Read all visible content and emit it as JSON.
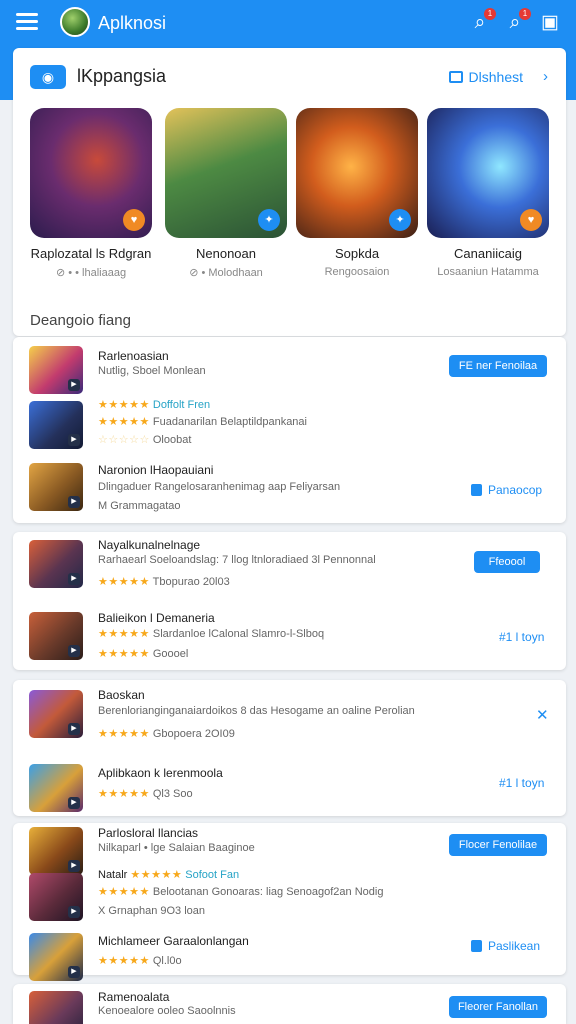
{
  "header": {
    "title": "Aplknosi",
    "icons": [
      "menu-icon",
      "search-icon",
      "search-alt-icon",
      "bookmark-icon"
    ],
    "badges": [
      "1",
      "1"
    ]
  },
  "featured": {
    "title": "lKppangsia",
    "link": "Dlshhest",
    "tiles": [
      {
        "name": "Raplozatal ls Rdgran",
        "sub": "⊘ • • lhaliaaag"
      },
      {
        "name": "Nenonoan",
        "sub": "⊘ • Molodhaan"
      },
      {
        "name": "Sopkda",
        "sub": "Rengoosaion"
      },
      {
        "name": "Cananiicaig",
        "sub": "Losaaniun Hatamma"
      }
    ],
    "section_label": "Deangoio fiang"
  },
  "lists": [
    {
      "items": [
        {
          "title": "Rarlenoasian",
          "lines": [
            {
              "text": "Nutlig, Sboel Monlean"
            }
          ],
          "action": {
            "type": "pill",
            "label": "FE ner Fenoilaa"
          }
        },
        {
          "title": "",
          "lines": [
            {
              "stars": "★★★★★",
              "note": "Doffolt Fren"
            },
            {
              "stars": "★★★★★",
              "text": "Fuadanarilan Belaptildpankanai"
            },
            {
              "stars": "☆☆☆☆☆",
              "text": "Oloobat"
            }
          ]
        },
        {
          "title": "Naronion lHaopauiani",
          "lines": [
            {
              "text": "Dlingaduer Rangelosaranhenimag aap Feliyarsan"
            },
            {
              "text": "M Grammagatao"
            }
          ],
          "action": {
            "type": "ghost",
            "label": "Panaocop"
          }
        }
      ]
    },
    {
      "items": [
        {
          "title": "Nayalkunalnelnage",
          "lines": [
            {
              "text": "Rarhaearl Soeloandslag: 7 llog ltnloradiaed 3l Pennonnal"
            },
            {
              "stars": "★★★★★",
              "text": "Tbopurao 20l03"
            }
          ],
          "action": {
            "type": "pill",
            "label": "Ffeoool"
          }
        },
        {
          "title": "Balieikon l Demaneria",
          "lines": [
            {
              "stars": "★★★★★",
              "text": "Slardanloe lCalonal Slamro-l-Slboq"
            },
            {
              "stars": "★★★★★",
              "text": "Goooel"
            }
          ],
          "action": {
            "type": "text",
            "label": "#1 l toyn"
          }
        }
      ]
    },
    {
      "items": [
        {
          "title": "Baoskan",
          "lines": [
            {
              "text": "Berenlorianginganaiardoikos 8 das Hesogame an oaline Perolian"
            },
            {
              "stars": "★★★★★",
              "text": "Gbopoera 2OI09"
            }
          ],
          "action": {
            "type": "close",
            "label": "✕"
          }
        },
        {
          "title": "Aplibkaon k lerenmoola",
          "lines": [
            {
              "stars": "★★★★★",
              "text": "Ql3 Soo"
            }
          ],
          "action": {
            "type": "text",
            "label": "#1 l toyn"
          }
        }
      ]
    },
    {
      "items": [
        {
          "title": "Parlosloral llancias",
          "lines": [
            {
              "text": "Nilkaparl • lge Salaian Baaginoe"
            }
          ],
          "action": {
            "type": "pill",
            "label": "Flocer Fenolilae"
          }
        },
        {
          "title": "",
          "lines": [
            {
              "prefix": "Natalr",
              "stars": "★★★★★",
              "note": "Sofoot Fan"
            },
            {
              "stars": "★★★★★",
              "text": "Belootanan Gonoaras: liag Senoagof2an Nodig"
            },
            {
              "text": "X Grnaphan 9O3 loan"
            }
          ]
        },
        {
          "title": "Michlameer Garaalonlangan",
          "lines": [
            {
              "stars": "★★★★★",
              "text": "Ql.l0o"
            }
          ],
          "action": {
            "type": "ghost",
            "label": "Paslikean"
          }
        }
      ]
    },
    {
      "items": [
        {
          "title": "Ramenoalata",
          "lines": [
            {
              "text": "Kenoealore ooleo Saoolnnis"
            }
          ],
          "action": {
            "type": "pill",
            "label": "Fleorer Fanollan"
          }
        }
      ]
    }
  ],
  "colors": {
    "primary": "#1e8ef3",
    "star": "#f7a81b",
    "badge_red": "#e53935"
  }
}
